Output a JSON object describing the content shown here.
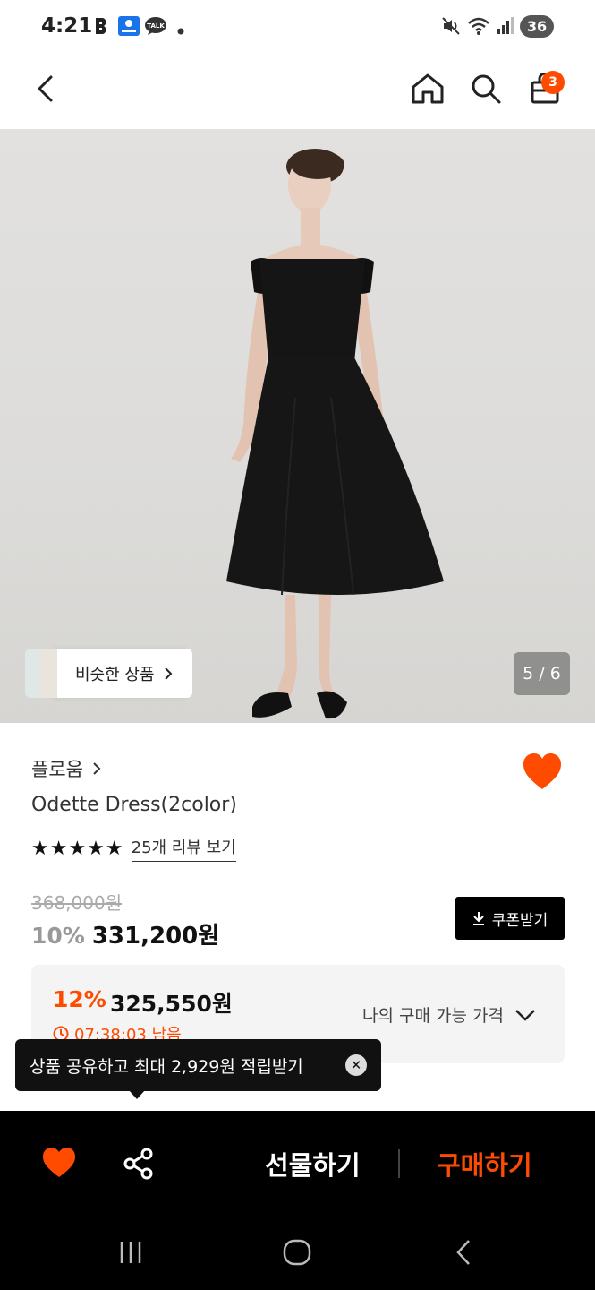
{
  "status_bar": {
    "time": "4:21",
    "icons": [
      "b-app-icon",
      "kakao-map-icon",
      "kakao-talk-icon",
      "dot-icon",
      "mute-icon",
      "wifi-icon",
      "signal-icon"
    ],
    "battery": "36"
  },
  "header": {
    "cart_count": "3",
    "icons": [
      "back-icon",
      "home-icon",
      "search-icon",
      "cart-icon"
    ]
  },
  "hero": {
    "similar_label": "비슷한 상품",
    "page_counter": "5 / 6"
  },
  "product": {
    "brand": "플로움",
    "name": "Odette Dress(2color)",
    "stars": "★★★★★",
    "rating": 5,
    "review_link": "25개 리뷰 보기",
    "original_price": "368,000원",
    "discount_pct": "10%",
    "sale_price": "331,200원",
    "coupon_label": "쿠폰받기"
  },
  "best_price": {
    "pct": "12%",
    "price": "325,550원",
    "timer": "07:38:03 남음",
    "label": "나의 구매 가능 가격"
  },
  "tooltip": {
    "text": "상품 공유하고 최대 2,929원 적립받기"
  },
  "action_bar": {
    "gift_label": "선물하기",
    "buy_label": "구매하기"
  },
  "colors": {
    "accent": "#ff4b00",
    "dark": "#000000",
    "box_bg": "#f4f4f4"
  }
}
